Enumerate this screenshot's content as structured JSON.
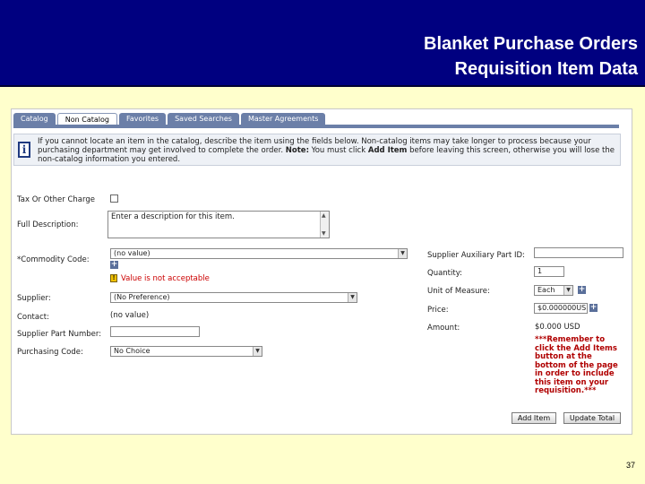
{
  "slide": {
    "title_line1": "Blanket Purchase Orders",
    "title_line2": "Requisition Item Data",
    "page_number": "37"
  },
  "tabs": [
    {
      "label": "Catalog",
      "active": false
    },
    {
      "label": "Non Catalog",
      "active": true
    },
    {
      "label": "Favorites",
      "active": false
    },
    {
      "label": "Saved Searches",
      "active": false
    },
    {
      "label": "Master Agreements",
      "active": false
    }
  ],
  "info": {
    "text_part1": "If you cannot locate an item in the catalog, describe the item using the fields below. Non-catalog items may take longer to process because your purchasing department may get involved to complete the order. ",
    "note_label": "Note:",
    "text_part2": " You must click ",
    "add_items_label": "Add Item",
    "text_part3": " before leaving this screen, otherwise you will lose the non-catalog information you entered."
  },
  "form": {
    "tax_label": "Tax Or Other Charge",
    "full_description_label": "Full Description:",
    "full_description_value": "Enter a description for this item.",
    "commodity_label": "*Commodity Code:",
    "commodity_value": "(no value)",
    "commodity_error": "Value is not acceptable",
    "supplier_label": "Supplier:",
    "supplier_value": "(No Preference)",
    "contact_label": "Contact:",
    "contact_value": "(no value)",
    "supplier_part_label": "Supplier Part Number:",
    "supplier_part_value": "",
    "purchasing_code_label": "Purchasing Code:",
    "purchasing_code_value": "No Choice",
    "aux_part_label": "Supplier Auxiliary Part ID:",
    "aux_part_value": "",
    "quantity_label": "Quantity:",
    "quantity_value": "1",
    "uom_label": "Unit of Measure:",
    "uom_value": "Each",
    "price_label": "Price:",
    "price_value": "$0.000000USD",
    "amount_label": "Amount:",
    "amount_value": "$0.000 USD"
  },
  "reminder": "***Remember to click the Add Items button at the bottom of the page in order to include this item on your requisition.***",
  "buttons": {
    "add_item": "Add Item",
    "update_total": "Update Total"
  }
}
